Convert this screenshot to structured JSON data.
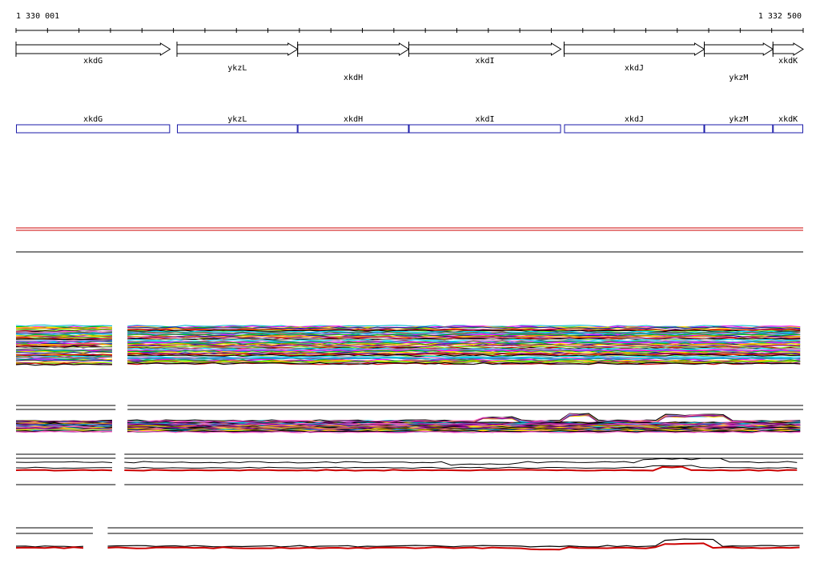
{
  "coordinates": {
    "start": "1 330 001",
    "end": "1 332 500",
    "start_value": 1330001,
    "end_value": 1332500
  },
  "genes": [
    {
      "name": "xkdG",
      "start": 1330001,
      "end": 1330490,
      "label_row": 0
    },
    {
      "name": "ykzL",
      "start": 1330512,
      "end": 1330895,
      "label_row": 1
    },
    {
      "name": "xkdH",
      "start": 1330895,
      "end": 1331248,
      "label_row": 2
    },
    {
      "name": "xkdI",
      "start": 1331248,
      "end": 1331731,
      "label_row": 0
    },
    {
      "name": "xkdJ",
      "start": 1331741,
      "end": 1332186,
      "label_row": 1
    },
    {
      "name": "ykzM",
      "start": 1332186,
      "end": 1332404,
      "label_row": 2
    },
    {
      "name": "xkdK",
      "start": 1332404,
      "end": 1332500,
      "label_row": 0
    }
  ],
  "colors": {
    "gene_arrow": "#000000",
    "annotation_box": "#1a1aa8",
    "reference_line": "#cc0000",
    "baseline": "#000000",
    "track_palette": [
      "#00bcd4",
      "#ff00ff",
      "#00c000",
      "#ffd800",
      "#1a1aa8",
      "#ff8c00",
      "#8b008b",
      "#7fff00",
      "#cc0000",
      "#000000",
      "#9e9e9e",
      "#00e5ff",
      "#ff66cc",
      "#556b2f",
      "#4169e1"
    ]
  },
  "tracks": [
    {
      "id": "dense-track-1",
      "gap": [
        1330317,
        1330355
      ],
      "line_count": 70
    },
    {
      "id": "dense-track-2",
      "gap": [
        1330317,
        1330355
      ],
      "line_count": 55
    },
    {
      "id": "pair-track-3",
      "gap": [
        1330317,
        1330345
      ]
    },
    {
      "id": "pair-track-4",
      "gap": [
        1330245,
        1330292
      ]
    }
  ]
}
